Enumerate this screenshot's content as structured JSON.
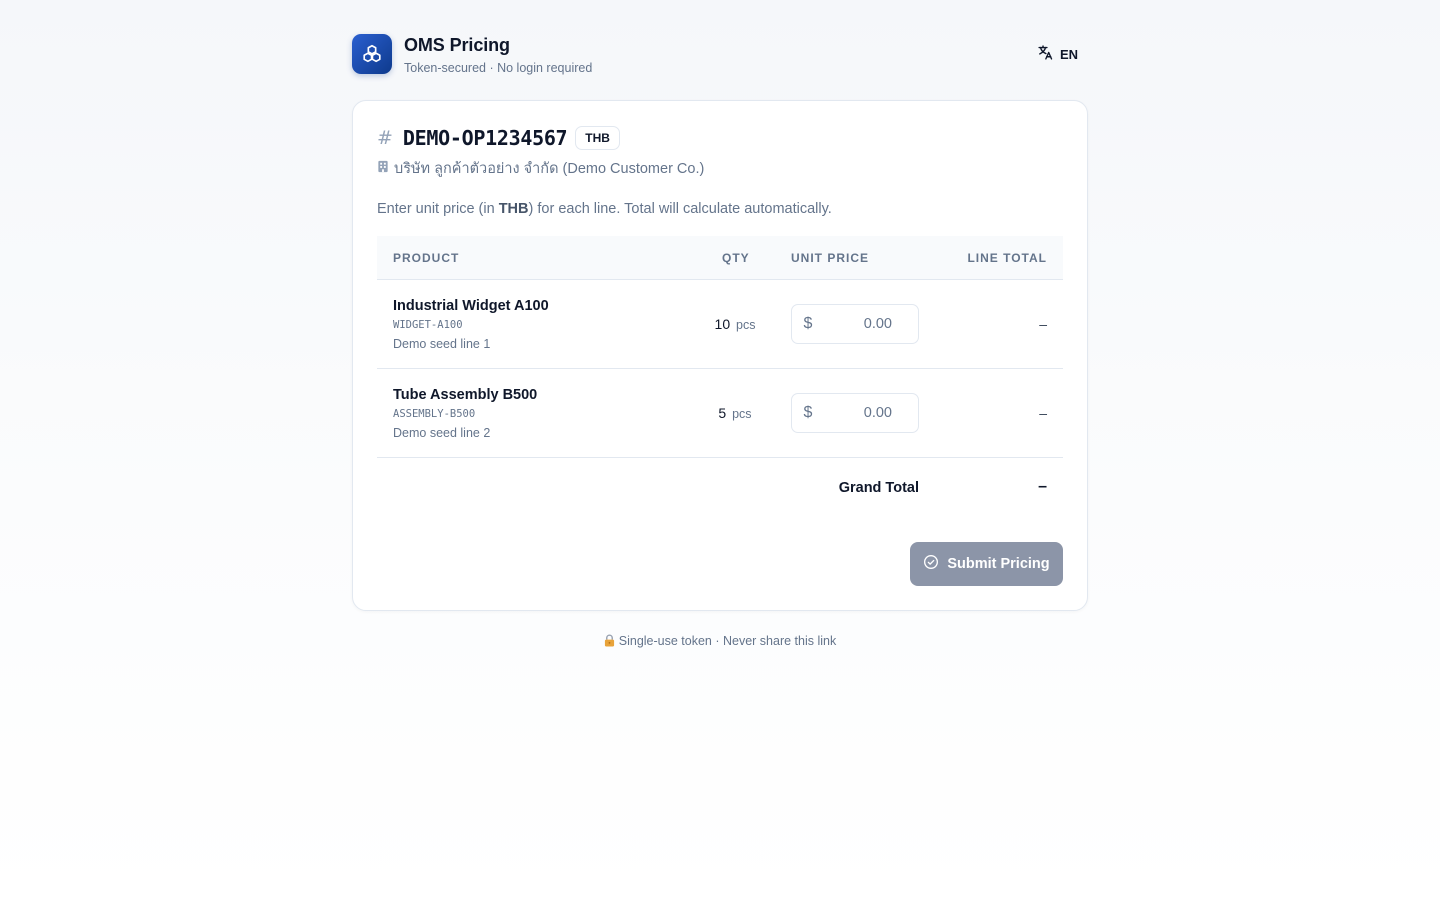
{
  "app": {
    "title": "OMS Pricing",
    "subtitle": "Token-secured · No login required",
    "language": "EN"
  },
  "order": {
    "id": "DEMO-OP1234567",
    "currency": "THB",
    "customer": "บริษัท ลูกค้าตัวอย่าง จำกัด (Demo Customer Co.)"
  },
  "instructions": {
    "before": "Enter unit price (in ",
    "currency": "THB",
    "after": ") for each line. Total will calculate automatically."
  },
  "table": {
    "headers": {
      "product": "PRODUCT",
      "qty": "QTY",
      "unit_price": "UNIT PRICE",
      "line_total": "LINE TOTAL"
    },
    "rows": [
      {
        "name": "Industrial Widget A100",
        "sku": "WIDGET-A100",
        "note": "Demo seed line 1",
        "qty": "10",
        "unit": "pcs",
        "currency_symbol": "$",
        "price_placeholder": "0.00",
        "line_total": "–"
      },
      {
        "name": "Tube Assembly B500",
        "sku": "ASSEMBLY-B500",
        "note": "Demo seed line 2",
        "qty": "5",
        "unit": "pcs",
        "currency_symbol": "$",
        "price_placeholder": "0.00",
        "line_total": "–"
      }
    ],
    "grand_total_label": "Grand Total",
    "grand_total_value": "–"
  },
  "actions": {
    "submit_label": "Submit Pricing"
  },
  "footer": {
    "text": "Single-use token · Never share this link"
  },
  "colors": {
    "brand": "#1e4fb8",
    "submit_disabled": "#8c95a8",
    "muted_text": "#64748b"
  },
  "icons": {
    "logo": "cubes-icon",
    "language": "translate-icon",
    "order": "hash-icon",
    "customer": "building-icon",
    "submit": "check-circle-icon",
    "footer": "lock-icon"
  }
}
